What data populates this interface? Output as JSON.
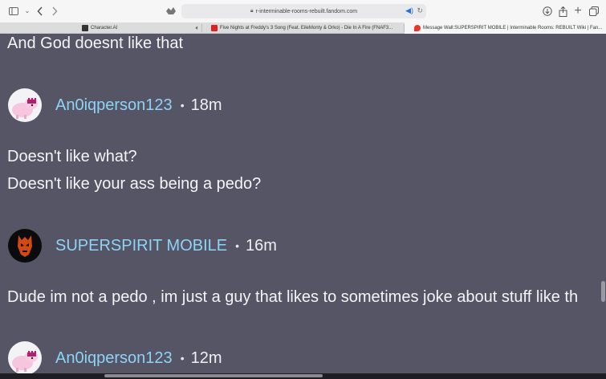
{
  "browser": {
    "url": "r-interminable-rooms-rebuilt.fandom.com",
    "tabs": [
      {
        "label": "Character.AI",
        "favicon_color": "#333333",
        "active": false
      },
      {
        "label": "Five Nights at Freddy's 3 Song (Feat. EileMonty & Orko) - Die In A Fire (FNAF3...",
        "favicon_color": "#e02020",
        "active": false
      },
      {
        "label": "Message Wall:SUPERSPIRIT MOBILE | Interminable Rooms: REBUILT Wiki | Fan...",
        "favicon_color": "#e8362c",
        "active": true
      }
    ]
  },
  "thread": {
    "line_1": "And God doesnt like that",
    "msg_1": {
      "user": "An0iqperson123",
      "dot": "•",
      "time": "18m"
    },
    "line_2": "Doesn't like what?",
    "line_3": "Doesn't like your ass being a pedo?",
    "msg_2": {
      "user": "SUPERSPIRIT MOBILE",
      "dot": "•",
      "time": "16m"
    },
    "line_4": "Dude im not a pedo , im just a guy that likes to sometimes joke about stuff like th",
    "msg_3": {
      "user": "An0iqperson123",
      "dot": "•",
      "time": "12m"
    }
  },
  "colors": {
    "page_bg": "#555566",
    "username": "#8ed3f5",
    "text": "#f4f4f6"
  },
  "icons": [
    "sidebar-icon",
    "chevron-down-icon",
    "back-icon",
    "forward-icon",
    "shield-icon",
    "lock-icon",
    "audio-icon",
    "reload-icon",
    "download-icon",
    "share-icon",
    "plus-icon",
    "tabs-icon",
    "speaker-icon"
  ]
}
